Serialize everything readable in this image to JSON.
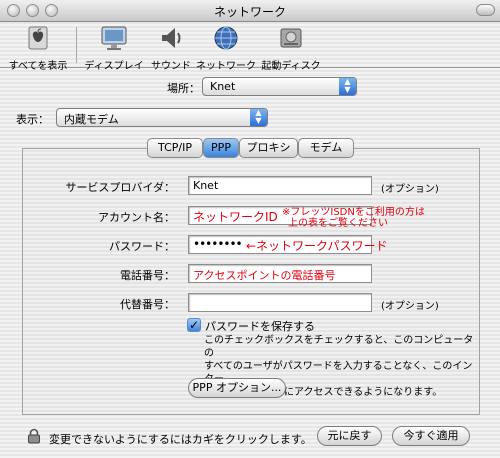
{
  "window": {
    "title": "ネットワーク"
  },
  "toolbar": {
    "items": [
      {
        "label": "すべてを表示",
        "icon": "show-all-icon"
      },
      {
        "label": "ディスプレイ",
        "icon": "display-icon"
      },
      {
        "label": "サウンド",
        "icon": "sound-icon"
      },
      {
        "label": "ネットワーク",
        "icon": "network-icon"
      },
      {
        "label": "起動ディスク",
        "icon": "startup-disk-icon"
      }
    ]
  },
  "location": {
    "label": "場所：",
    "value": "Knet"
  },
  "show": {
    "label": "表示：",
    "value": "内蔵モデム"
  },
  "tabs": [
    {
      "label": "TCP/IP",
      "active": false
    },
    {
      "label": "PPP",
      "active": true
    },
    {
      "label": "プロキシ",
      "active": false
    },
    {
      "label": "モデム",
      "active": false
    }
  ],
  "ppp": {
    "service_provider": {
      "label": "サービスプロバイダ：",
      "value": "Knet",
      "suffix": "(オプション)"
    },
    "account": {
      "label": "アカウント名：",
      "value": "ネットワークID",
      "note_line1": "※フレッツISDNをご利用の方は",
      "note_line2": "上の表をご覧ください"
    },
    "password": {
      "label": "パスワード：",
      "value": "••••••••",
      "note": "←ネットワークパスワード"
    },
    "phone": {
      "label": "電話番号：",
      "value": "アクセスポイントの電話番号"
    },
    "alt_phone": {
      "label": "代替番号：",
      "value": "",
      "suffix": "(オプション)"
    },
    "save_password": {
      "label": "パスワードを保存する",
      "checked": true,
      "description": [
        "このチェックボックスをチェックすると、このコンピュータの",
        "すべてのユーザがパスワードを入力することなく、このインター",
        "ネットアカウントにアクセスできるようになります。"
      ]
    },
    "options_button": "PPP オプション..."
  },
  "footer": {
    "lock_text": "変更できないようにするにはカギをクリックします。",
    "revert_button": "元に戻す",
    "apply_button": "今すぐ適用"
  },
  "colors": {
    "annotation": "#e0000f",
    "accent": "#3a82dc"
  }
}
